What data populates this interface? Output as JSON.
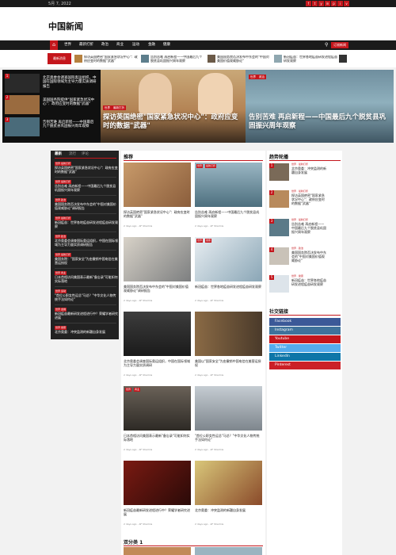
{
  "topbar": {
    "date": "5月 7, 2022",
    "social": [
      "f",
      "t",
      "y",
      "in",
      "p",
      "i",
      "v",
      "g"
    ]
  },
  "header": {
    "logo": "中国新闻"
  },
  "nav": {
    "items": [
      "世界",
      "最新打折",
      "政治",
      "商业",
      "运动",
      "金融",
      "健康"
    ],
    "button": "订阅新闻"
  },
  "ticker": {
    "label": "最新消息",
    "items": [
      "探访英国绝密\"国家紧急状况中心\"：政府应变时的数据\"武器\"",
      "告别苦难 再启新程——中国最后九个脱贫县巩固振兴周年观察",
      "美国国务院否决发布中东会的\"中国对美国价值观威胁论\"",
      "新冠疫苗：世界各地疫苗研发进程疫苗研发观察"
    ]
  },
  "hero": {
    "left": [
      {
        "num": "1",
        "text": "北京奥委会调查国际奥运组织，中国在国际领域为主导力量实质调研报告"
      },
      {
        "num": "2",
        "text": "美国国务院提供\"国家紧急状况中心\"：政府应变时的数据\"武器\""
      },
      {
        "num": "3",
        "text": "告别苦难 再启新程——中国最后九个脱贫县巩固振兴周年观察"
      }
    ],
    "mid": {
      "tags": [
        "世界",
        "最新打折"
      ],
      "title": "探访英国绝密\"国家紧急状况中心\"：政府应变时的数据\"武器\""
    },
    "right": {
      "tags": [
        "世界",
        "政治"
      ],
      "title": "告别苦难 再启新程——中国最后九个脱贫县巩固振兴周年观察"
    }
  },
  "left_col": {
    "tabs": [
      "最新",
      "流行",
      "评论"
    ],
    "items": [
      {
        "tag": "世界 最新打折",
        "text": "探访英国绝密\"国家紧急状况中心\"：政府应变时的数据\"武器\""
      },
      {
        "tag": "世界 最新打折",
        "text": "告别苦难 再启新程——中国最后九个脱贫县巩固振兴周年观察"
      },
      {
        "tag": "世界 政治",
        "text": "美国国务院否决发布中东会的\"中国对美国价值观威胁论\"调研报告"
      },
      {
        "tag": "世界 最新打折",
        "text": "新冠疫苗：世界各地疫苗研发进程疫苗研发观察"
      },
      {
        "tag": "世界 政治",
        "text": "北京奥委会调查国际奥运组织，中国在国际领域为主导力量实质调研报告"
      },
      {
        "tag": "世界 最新打折",
        "text": "美国务院：\"国家安全\"为由撤销中国电信在美营运授权"
      },
      {
        "tag": "世界 商业",
        "text": "日本首相访问美国表示最新\"备忘录\"可能如何实际落地"
      },
      {
        "tag": "世界 运动",
        "text": "\"首位公职女性运总\"马总？\"中华文化人物传统手法如何论\""
      },
      {
        "tag": "世界 金融",
        "text": "新冠疫苗最新研发进程进行中？荣耀学者研究进展"
      },
      {
        "tag": "世界 健康",
        "text": "北京奥委：冲突监测的新疆自身发展"
      }
    ]
  },
  "main": {
    "section1": "推荐",
    "cards": [
      {
        "tags": [
          "世界",
          "最新打折"
        ],
        "text": "探访英国绝密\"国家紧急状况中心\"：政府应变时的数据\"武器\"",
        "meta": "2 days ago · AF Sharmis"
      },
      {
        "tags": [
          "世界",
          "最新打折"
        ],
        "text": "告别苦难 再启新程——中国最后九个脱贫县巩固振兴周年观察",
        "meta": "2 days ago · AF Sharmis"
      },
      {
        "tags": [
          "世界",
          "政治"
        ],
        "text": "美国国务院否决发布中东会的\"中国对美国价值观威胁论\"调研报告",
        "meta": "2 days ago · AF Sharmis"
      },
      {
        "tags": [
          "世界",
          "健康"
        ],
        "text": "新冠疫苗：世界各地疫苗研发进程疫苗研发观察",
        "meta": "2 days ago · AF Sharmis"
      },
      {
        "tags": [
          "世界",
          "运动"
        ],
        "text": "北京奥委会调查国际奥运组织，中国在国际领域为主导力量实质调研",
        "meta": "2 days ago · AF Sharmis"
      },
      {
        "tags": [
          "世界",
          "政治"
        ],
        "text": "美国以\"国家安全\"为由撤销中国电信在美营运授权",
        "meta": "2 days ago · AF Sharmis"
      },
      {
        "tags": [
          "世界",
          "商业"
        ],
        "text": "日本首相访问美国表示最新\"备忘录\"可能如何实际落地",
        "meta": "2 days ago · AF Sharmis"
      },
      {
        "tags": [
          "世界",
          "政治"
        ],
        "text": "\"首位公职女性运总\"马总？\"中华文化人物传统手法如何论\"",
        "meta": "2 days ago · AF Sharmis"
      },
      {
        "tags": [
          "世界",
          "金融"
        ],
        "text": "新冠疫苗最新研发进程进行中？荣耀学者研究进展",
        "meta": "2 days ago · AF Sharmis"
      },
      {
        "tags": [
          "世界",
          "健康"
        ],
        "text": "北京奥委：冲突监测的新疆自身发展",
        "meta": "2 days ago · AF Sharmis"
      }
    ],
    "section2": "双分类 1"
  },
  "right_col": {
    "section1": "趋势轮播",
    "items": [
      {
        "num": "1",
        "tag": "世界 · 最新打折",
        "text": "北京奥委：冲突监测的新疆自身发展"
      },
      {
        "num": "2",
        "tag": "世界 · 最新打折",
        "text": "探访英国绝密\"国家紧急状况中心\"：政府应变时的数据\"武器\""
      },
      {
        "num": "3",
        "tag": "世界 · 最新打折",
        "text": "告别苦难 再启新程——中国最后九个脱贫县巩固振兴周年观察"
      },
      {
        "num": "4",
        "tag": "世界 · 政治",
        "text": "美国国务院否决发布中东会的\"中国对美国价值观威胁论\""
      },
      {
        "num": "5",
        "tag": "世界 · 健康",
        "text": "新冠疫苗：世界各地疫苗研发进程疫苗研发观察"
      }
    ],
    "section2": "社交链接",
    "social": [
      {
        "label": "Facebook",
        "color": "#3b5998"
      },
      {
        "label": "Instagram",
        "color": "#3f729b"
      },
      {
        "label": "Youtube",
        "color": "#c4161c"
      },
      {
        "label": "Twitter",
        "color": "#55acee"
      },
      {
        "label": "LinkedIn",
        "color": "#0e76a8"
      },
      {
        "label": "Pinterest",
        "color": "#cb2027"
      }
    ]
  }
}
